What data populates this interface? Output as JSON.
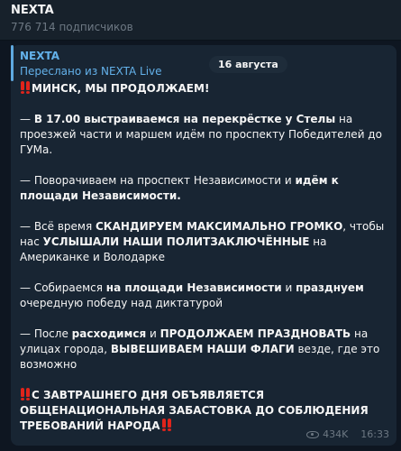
{
  "channel": {
    "title": "NEXTA",
    "subscribers": "776 714 подписчиков"
  },
  "message": {
    "author": "NEXTA",
    "forwarded_from": "Переслано из NEXTA Live",
    "date_badge": "16 августа",
    "views": "434K",
    "time": "16:33",
    "p1": [
      {
        "t": "МИНСК, МЫ ПРОДОЛЖАЕМ!",
        "b": true
      }
    ],
    "p2": [
      {
        "t": "— "
      },
      {
        "t": "В 17.00 выстраиваемся на перекрёстке у Стелы",
        "b": true
      },
      {
        "t": " на проезжей части и маршем идём по проспекту Победителей до ГУМа."
      }
    ],
    "p3": [
      {
        "t": "— Поворачиваем на проспект Независимости и "
      },
      {
        "t": "идём к площади Независимости.",
        "b": true
      }
    ],
    "p4": [
      {
        "t": "— Всё время "
      },
      {
        "t": "СКАНДИРУЕМ МАКСИМАЛЬНО ГРОМКО",
        "b": true
      },
      {
        "t": ", чтобы нас "
      },
      {
        "t": "УСЛЫШАЛИ НАШИ ПОЛИТЗАКЛЮЧЁННЫЕ",
        "b": true
      },
      {
        "t": " на Американке и Володарке"
      }
    ],
    "p5": [
      {
        "t": "— Собираемся "
      },
      {
        "t": "на площади Независимости",
        "b": true
      },
      {
        "t": " и "
      },
      {
        "t": "празднуем",
        "b": true
      },
      {
        "t": " очередную победу над диктатурой"
      }
    ],
    "p6": [
      {
        "t": "— После "
      },
      {
        "t": "расходимся",
        "b": true
      },
      {
        "t": " и "
      },
      {
        "t": "ПРОДОЛЖАЕМ ПРАЗДНОВАТЬ",
        "b": true
      },
      {
        "t": " на улицах города, "
      },
      {
        "t": "ВЫВЕШИВАЕМ НАШИ ФЛАГИ",
        "b": true
      },
      {
        "t": " везде, где это возможно"
      }
    ],
    "p7": [
      {
        "t": "С ЗАВТРАШНЕГО ДНЯ ОБЪЯВЛЯЕТСЯ ОБЩЕНАЦИОНАЛЬНАЯ ЗАБАСТОВКА ДО СОБЛЮДЕНИЯ ТРЕБОВАНИЙ НАРОДА",
        "b": true
      }
    ]
  }
}
